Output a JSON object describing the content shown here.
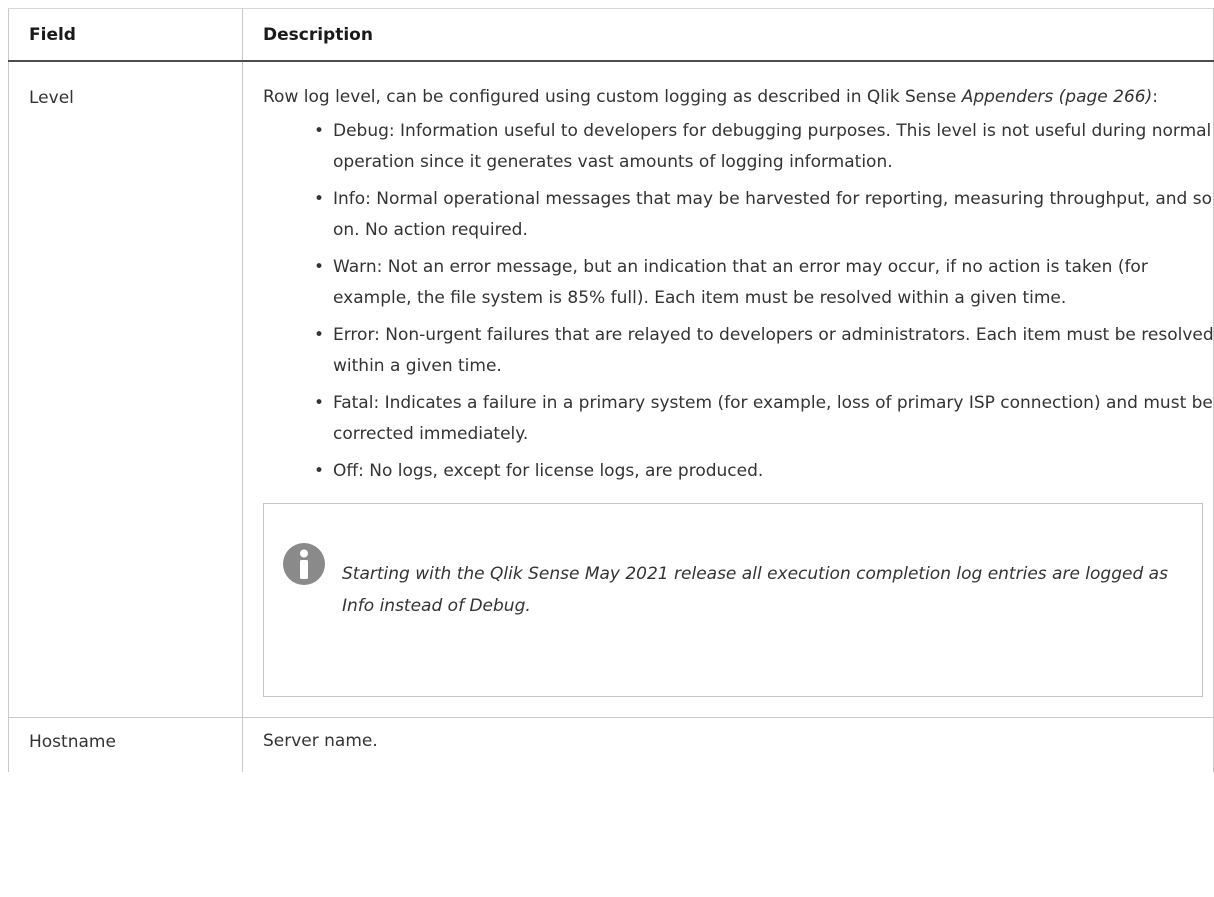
{
  "table": {
    "headers": {
      "field": "Field",
      "description": "Description"
    },
    "rows": [
      {
        "field": "Level",
        "intro_text": "Row log level, can be configured using custom logging as described in Qlik Sense ",
        "intro_link": "Appenders (page 266)",
        "intro_suffix": ":",
        "bullets": [
          "Debug: Information useful to developers for debugging purposes. This level is not useful during normal operation since it generates vast amounts of logging information.",
          "Info: Normal operational messages that may be harvested for reporting, measuring throughput, and so on. No action required.",
          "Warn: Not an error message, but an indication that an error may occur, if no action is taken (for example, the file system is 85% full). Each item must be resolved within a given time.",
          "Error: Non-urgent failures that are relayed to developers or administrators. Each item must be resolved within a given time.",
          "Fatal: Indicates a failure in a primary system (for example, loss of primary ISP connection) and must be corrected immediately.",
          "Off: No logs, except for license logs, are produced."
        ],
        "note": {
          "icon": "info-icon",
          "text": "Starting with the Qlik Sense May 2021 release all execution completion log entries are logged as Info instead of Debug."
        }
      },
      {
        "field": "Hostname",
        "description": "Server name."
      }
    ]
  },
  "colors": {
    "icon_fill": "#8a8a8a",
    "border": "#c9c9c9",
    "header_rule": "#4d4d4d"
  }
}
